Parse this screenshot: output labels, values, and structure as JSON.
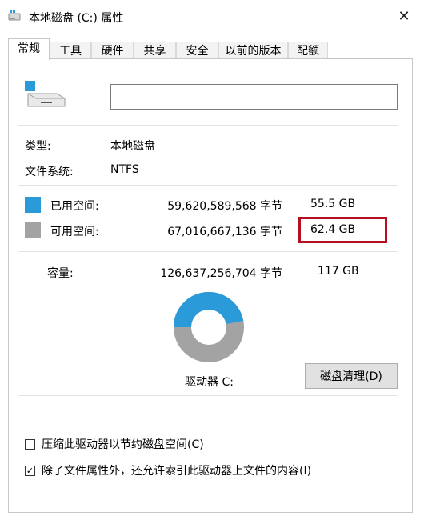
{
  "window": {
    "title": "本地磁盘 (C:) 属性",
    "close_glyph": "✕"
  },
  "tabs": [
    {
      "label": "常规",
      "active": true
    },
    {
      "label": "工具",
      "active": false
    },
    {
      "label": "硬件",
      "active": false
    },
    {
      "label": "共享",
      "active": false
    },
    {
      "label": "安全",
      "active": false
    },
    {
      "label": "以前的版本",
      "active": false
    },
    {
      "label": "配额",
      "active": false
    }
  ],
  "general": {
    "drive_name_value": "",
    "type_label": "类型:",
    "type_value": "本地磁盘",
    "fs_label": "文件系统:",
    "fs_value": "NTFS",
    "used": {
      "label": "已用空间:",
      "bytes": "59,620,589,568 字节",
      "size": "55.5 GB",
      "color": "#2b9ad8"
    },
    "free": {
      "label": "可用空间:",
      "bytes": "67,016,667,136 字节",
      "size": "62.4 GB",
      "color": "#a3a3a3"
    },
    "capacity": {
      "label": "容量:",
      "bytes": "126,637,256,704 字节",
      "size": "117 GB"
    },
    "used_fraction": 0.4708,
    "drive_label": "驱动器 C:",
    "cleanup_button": "磁盘清理(D)"
  },
  "options": {
    "compress": {
      "label": "压缩此驱动器以节约磁盘空间(C)",
      "checked": false
    },
    "index": {
      "label": "除了文件属性外，还允许索引此驱动器上文件的内容(I)",
      "checked": true
    }
  },
  "highlight_color": "#b5101f"
}
